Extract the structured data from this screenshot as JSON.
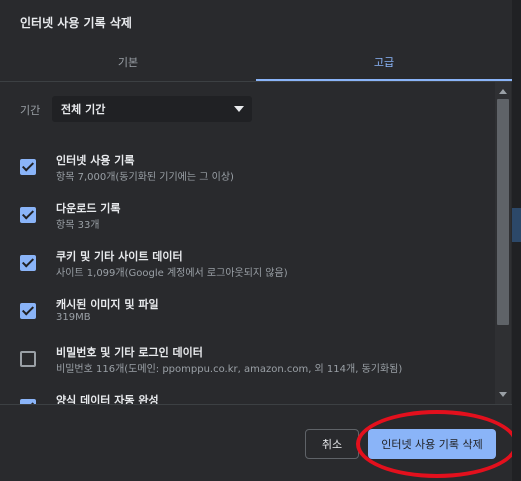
{
  "dialog": {
    "title": "인터넷 사용 기록 삭제",
    "tabs": [
      {
        "label": "기본",
        "active": false
      },
      {
        "label": "고급",
        "active": true
      }
    ],
    "time_range": {
      "label": "기간",
      "selected": "전체 기간"
    },
    "items": [
      {
        "title": "인터넷 사용 기록",
        "subtitle": "항목 7,000개(동기화된 기기에는 그 이상)",
        "checked": true
      },
      {
        "title": "다운로드 기록",
        "subtitle": "항목 33개",
        "checked": true
      },
      {
        "title": "쿠키 및 기타 사이트 데이터",
        "subtitle": "사이트 1,099개(Google 계정에서 로그아웃되지 않음)",
        "checked": true
      },
      {
        "title": "캐시된 이미지 및 파일",
        "subtitle": "319MB",
        "checked": true
      },
      {
        "title": "비밀번호 및 기타 로그인 데이터",
        "subtitle": "비밀번호 116개(도메인: ppomppu.co.kr, amazon.com, 외 114개, 동기화됨)",
        "checked": false
      },
      {
        "title": "양식 데이터 자동 완성",
        "subtitle": "",
        "checked": true
      }
    ],
    "buttons": {
      "cancel": "취소",
      "confirm": "인터넷 사용 기록 삭제"
    }
  },
  "colors": {
    "accent": "#8ab4f8",
    "background": "#292a2d",
    "annotation": "#e3101d"
  }
}
